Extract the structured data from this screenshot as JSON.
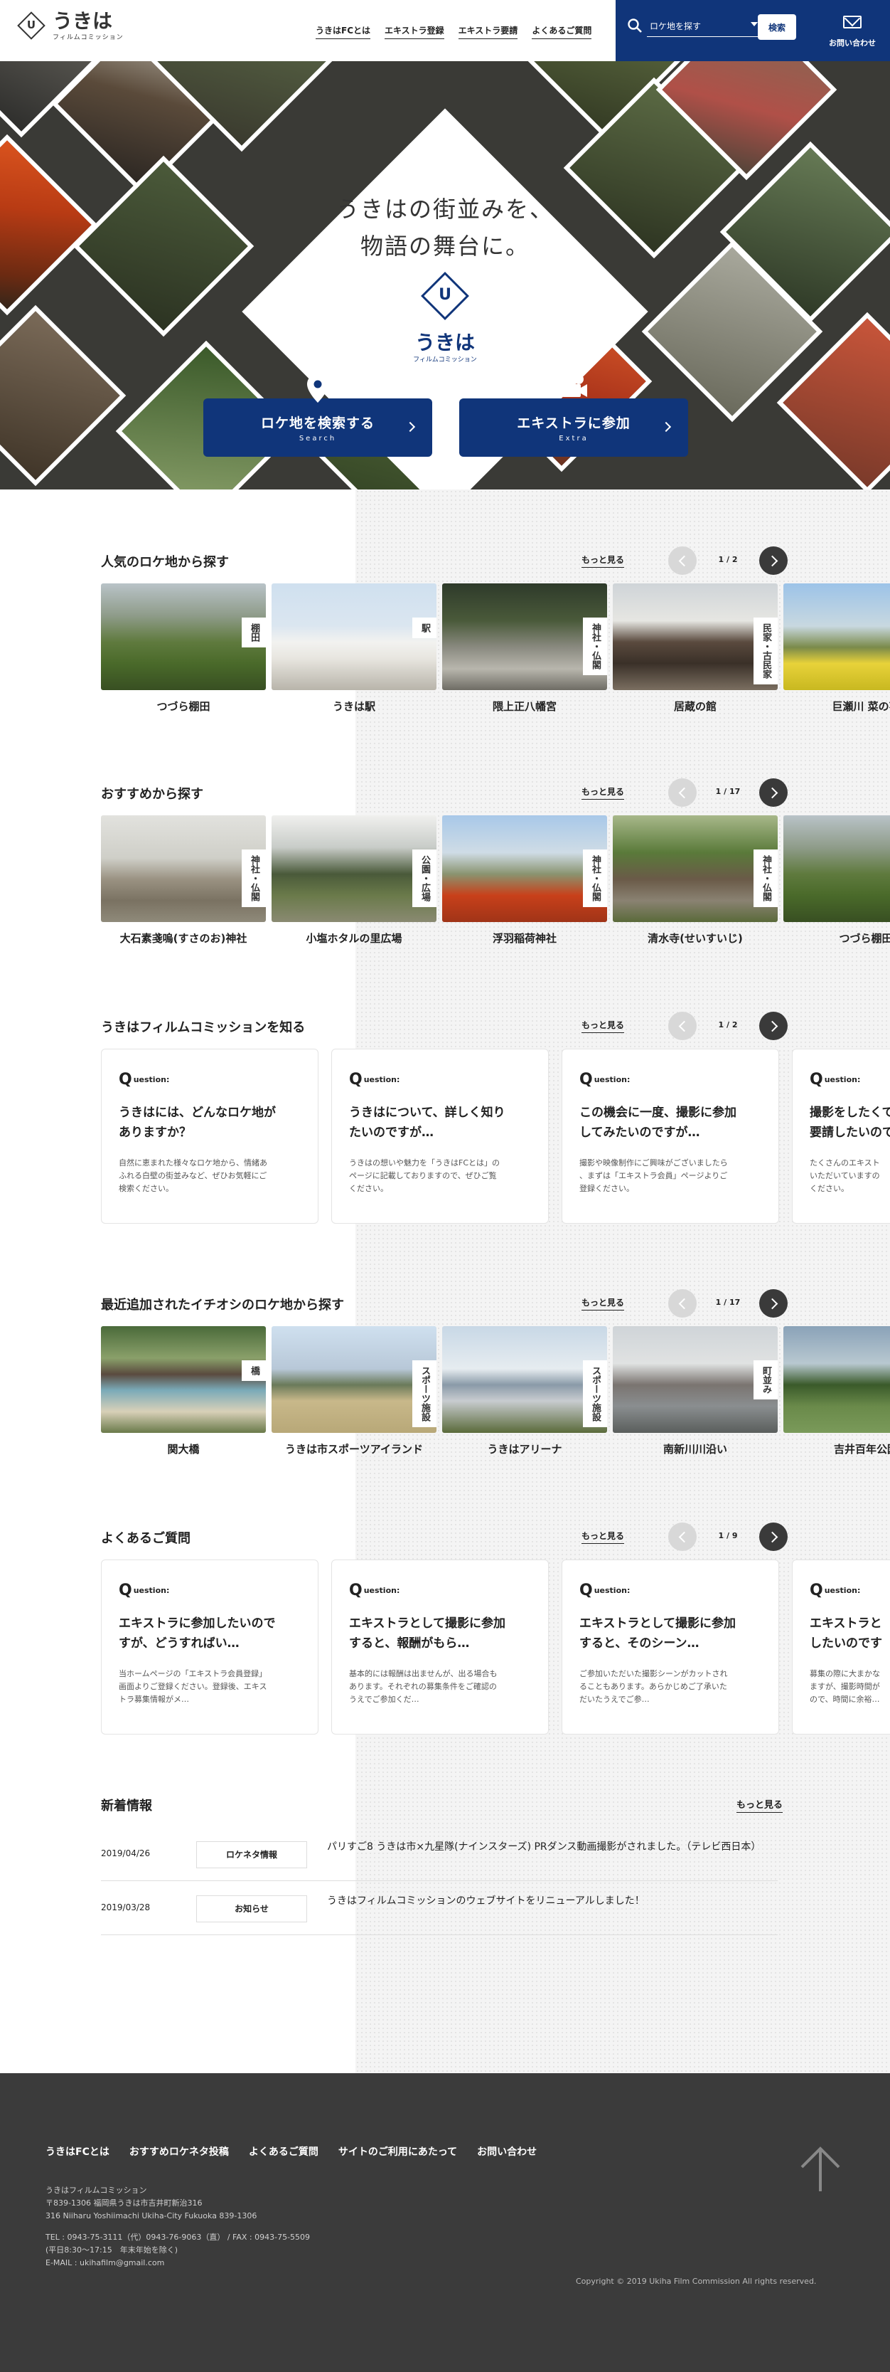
{
  "header": {
    "logo_mark": "U",
    "logo_text": "うきは",
    "logo_sub": "フィルムコミッション",
    "nav": [
      "うきはFCとは",
      "エキストラ登録",
      "エキストラ要請",
      "よくあるご質問"
    ],
    "search_select": "ロケ地を探す",
    "search_button": "検索",
    "contact": "お問い合わせ"
  },
  "hero": {
    "title_line1": "うきはの街並みを、",
    "title_line2": "物語の舞台に。",
    "logo_mark": "U",
    "logo_text": "うきは",
    "logo_sub": "フィルムコミッション",
    "btn_search": {
      "label": "ロケ地を検索する",
      "sub": "Search"
    },
    "btn_extra": {
      "label": "エキストラに参加",
      "sub": "Extra"
    }
  },
  "common": {
    "more": "もっと見る"
  },
  "popular": {
    "title": "人気のロケ地から探す",
    "page": "1 / 2",
    "cards": [
      {
        "name": "つづら棚田",
        "tag": "棚田",
        "photo": "terraces"
      },
      {
        "name": "うきは駅",
        "tag": "駅",
        "photo": "station"
      },
      {
        "name": "隈上正八幡宮",
        "tag": "神社・仏閣",
        "photo": "torii"
      },
      {
        "name": "居蔵の館",
        "tag": "民家・古民家",
        "photo": "oldhouse"
      },
      {
        "name": "巨瀬川 菜の花",
        "tag": "",
        "photo": "rapeflower"
      }
    ]
  },
  "recommended": {
    "title": "おすすめから探す",
    "page": "1 / 17",
    "cards": [
      {
        "name": "大石素戔嗚(すさのお)神社",
        "tag": "神社・仏閣",
        "photo": "torii2"
      },
      {
        "name": "小塩ホタルの里広場",
        "tag": "公園・広場",
        "photo": "village"
      },
      {
        "name": "浮羽稲荷神社",
        "tag": "神社・仏閣",
        "photo": "redgates"
      },
      {
        "name": "清水寺(せいすいじ)",
        "tag": "神社・仏閣",
        "photo": "temple"
      },
      {
        "name": "つづら棚田",
        "tag": "",
        "photo": "terraces"
      }
    ]
  },
  "know": {
    "title": "うきはフィルムコミッションを知る",
    "page": "1 / 2",
    "q_label": "uestion:",
    "cards": [
      {
        "title_l1": "うきはには、どんなロケ地が",
        "title_l2": "ありますか？",
        "body_l1": "自然に恵まれた様々なロケ地から、情緒あ",
        "body_l2": "ふれる白壁の街並みなど、ぜひお気軽にご",
        "body_l3": "検索ください。"
      },
      {
        "title_l1": "うきはについて、詳しく知り",
        "title_l2": "たいのですが…",
        "body_l1": "うきはの想いや魅力を「うきはFCとは」の",
        "body_l2": "ページに記載しておりますので、ぜひご覧",
        "body_l3": "ください。"
      },
      {
        "title_l1": "この機会に一度、撮影に参加",
        "title_l2": "してみたいのですが…",
        "body_l1": "撮影や映像制作にご興味がございましたら",
        "body_l2": "、まずは「エキストラ会員」ページよりご",
        "body_l3": "登録ください。"
      },
      {
        "title_l1": "撮影をしたくて",
        "title_l2": "要請したいので",
        "body_l1": "たくさんのエキスト",
        "body_l2": "いただいていますの",
        "body_l3": "ください。"
      }
    ]
  },
  "recent": {
    "title": "最近追加されたイチオシのロケ地から探す",
    "page": "1 / 17",
    "cards": [
      {
        "name": "関大橋",
        "tag": "橋",
        "photo": "bridge"
      },
      {
        "name": "うきは市スポーツアイランド",
        "tag": "スポーツ施設",
        "photo": "field"
      },
      {
        "name": "うきはアリーナ",
        "tag": "スポーツ施設",
        "photo": "arena"
      },
      {
        "name": "南新川川沿い",
        "tag": "町並み",
        "photo": "river"
      },
      {
        "name": "吉井百年公園",
        "tag": "",
        "photo": "park"
      }
    ]
  },
  "faq": {
    "title": "よくあるご質問",
    "page": "1 / 9",
    "q_label": "uestion:",
    "cards": [
      {
        "title_l1": "エキストラに参加したいので",
        "title_l2": "すが、どうすればい…",
        "body_l1": "当ホームページの「エキストラ会員登録」",
        "body_l2": "画面よりご登録ください。登録後、エキス",
        "body_l3": "トラ募集情報がメ…"
      },
      {
        "title_l1": "エキストラとして撮影に参加",
        "title_l2": "すると、報酬がもら…",
        "body_l1": "基本的には報酬は出ませんが、出る場合も",
        "body_l2": "あります。それぞれの募集条件をご確認の",
        "body_l3": "うえでご参加くだ…"
      },
      {
        "title_l1": "エキストラとして撮影に参加",
        "title_l2": "すると、そのシーン…",
        "body_l1": "ご参加いただいた撮影シーンがカットされ",
        "body_l2": "ることもあります。あらかじめご了承いた",
        "body_l3": "だいたうえでご参…"
      },
      {
        "title_l1": "エキストラと",
        "title_l2": "したいのです",
        "body_l1": "募集の際に大まかな",
        "body_l2": "ますが、撮影時間が",
        "body_l3": "ので、時間に余裕…"
      }
    ]
  },
  "news": {
    "title": "新着情報",
    "items": [
      {
        "date": "2019/04/26",
        "category": "ロケネタ情報",
        "text": "パリすご8 うきは市×九星隊(ナインスターズ) PRダンス動画撮影がされました。（テレビ西日本）"
      },
      {
        "date": "2019/03/28",
        "category": "お知らせ",
        "text": "うきはフィルムコミッションのウェブサイトをリニューアルしました！"
      }
    ]
  },
  "footer": {
    "nav": [
      "うきはFCとは",
      "おすすめロケネタ投稿",
      "よくあるご質問",
      "サイトのご利用にあたって",
      "お問い合わせ"
    ],
    "org": "うきはフィルムコミッション",
    "addr1": "〒839-1306 福岡県うきは市吉井町新治316",
    "addr2": "316 Niiharu Yoshiimachi Ukiha-City Fukuoka 839-1306",
    "tel": "TEL : 0943-75-3111（代）0943-76-9063（直） / FAX : 0943-75-5509",
    "hours": "(平日8:30～17:15　年末年始を除く)",
    "email": "E-MAIL : ukihafilm@gmail.com",
    "copyright": "Copyright © 2019 Ukiha Film Commission All rights reserved."
  }
}
